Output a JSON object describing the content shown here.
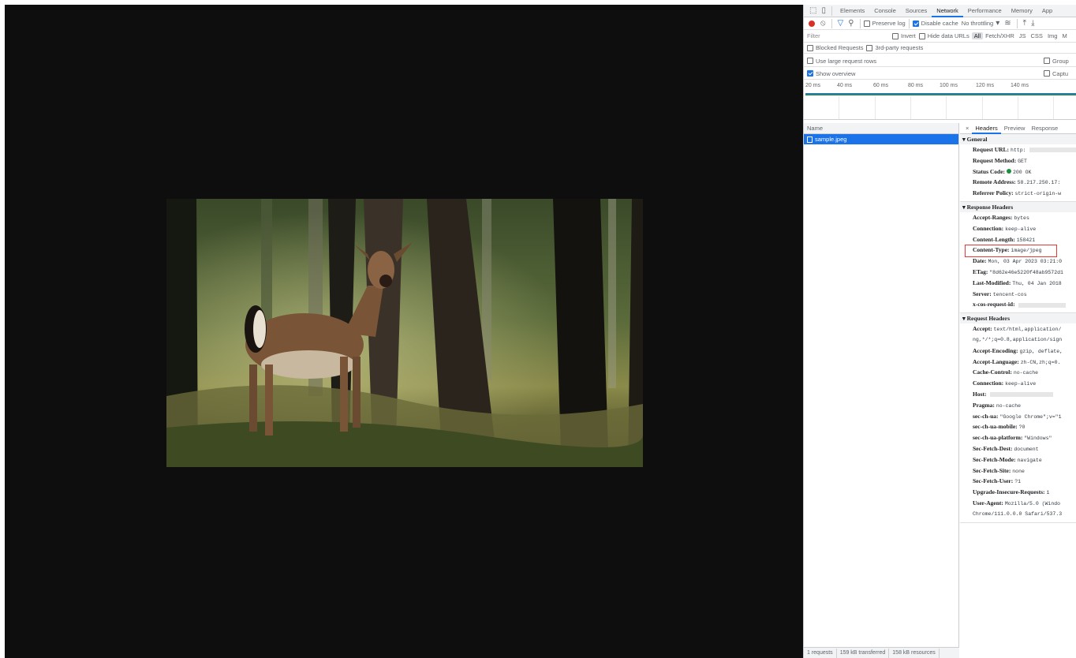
{
  "devtools": {
    "tabs": [
      "Elements",
      "Console",
      "Sources",
      "Network",
      "Performance",
      "Memory",
      "App"
    ],
    "active_tab": "Network",
    "toolbar": {
      "preserve_log": "Preserve log",
      "disable_cache": "Disable cache",
      "throttling": "No throttling"
    },
    "filter": {
      "placeholder": "Filter",
      "invert": "Invert",
      "hide_data_urls": "Hide data URLs",
      "types": [
        "All",
        "Fetch/XHR",
        "JS",
        "CSS",
        "Img",
        "M"
      ]
    },
    "blocked_requests": "Blocked Requests",
    "third_party": "3rd-party requests",
    "large_rows": "Use large request rows",
    "group_opt": "Group",
    "show_overview": "Show overview",
    "capture_opt": "Captu",
    "timeline_ticks": [
      "20 ms",
      "40 ms",
      "60 ms",
      "80 ms",
      "100 ms",
      "120 ms",
      "140 ms"
    ],
    "name_header": "Name",
    "requests": [
      {
        "name": "sample.jpeg"
      }
    ],
    "status_bar": [
      "1 requests",
      "159 kB transferred",
      "158 kB resources"
    ],
    "detail_tabs": [
      "×",
      "Headers",
      "Preview",
      "Response"
    ],
    "active_detail_tab": "Headers",
    "general": {
      "title": "General",
      "request_url_k": "Request URL:",
      "request_url_v": "http:",
      "method_k": "Request Method:",
      "method_v": "GET",
      "status_k": "Status Code:",
      "status_v": "200 OK",
      "remote_k": "Remote Address:",
      "remote_v": "58.217.250.17:",
      "referrer_k": "Referrer Policy:",
      "referrer_v": "strict-origin-w"
    },
    "response_headers": {
      "title": "Response Headers",
      "items": [
        {
          "k": "Accept-Ranges:",
          "v": "bytes"
        },
        {
          "k": "Connection:",
          "v": "keep-alive"
        },
        {
          "k": "Content-Length:",
          "v": "158421"
        },
        {
          "k": "Content-Type:",
          "v": "image/jpeg"
        },
        {
          "k": "Date:",
          "v": "Mon, 03 Apr 2023 03:21:0"
        },
        {
          "k": "ETag:",
          "v": "\"8d62e46e5220f48ab9572d1"
        },
        {
          "k": "Last-Modified:",
          "v": "Thu, 04 Jan 2018"
        },
        {
          "k": "Server:",
          "v": "tencent-cos"
        },
        {
          "k": "x-cos-request-id:",
          "v": ""
        }
      ]
    },
    "request_headers": {
      "title": "Request Headers",
      "items": [
        {
          "k": "Accept:",
          "v": "text/html,application/"
        },
        {
          "k": "",
          "v": "ng,*/*;q=0.8,application/sign"
        },
        {
          "k": "Accept-Encoding:",
          "v": "gzip, deflate,"
        },
        {
          "k": "Accept-Language:",
          "v": "zh-CN,zh;q=0."
        },
        {
          "k": "Cache-Control:",
          "v": "no-cache"
        },
        {
          "k": "Connection:",
          "v": "keep-alive"
        },
        {
          "k": "Host:",
          "v": ""
        },
        {
          "k": "Pragma:",
          "v": "no-cache"
        },
        {
          "k": "sec-ch-ua:",
          "v": "\"Google Chrome\";v=\"1"
        },
        {
          "k": "sec-ch-ua-mobile:",
          "v": "?0"
        },
        {
          "k": "sec-ch-ua-platform:",
          "v": "\"Windows\""
        },
        {
          "k": "Sec-Fetch-Dest:",
          "v": "document"
        },
        {
          "k": "Sec-Fetch-Mode:",
          "v": "navigate"
        },
        {
          "k": "Sec-Fetch-Site:",
          "v": "none"
        },
        {
          "k": "Sec-Fetch-User:",
          "v": "?1"
        },
        {
          "k": "Upgrade-Insecure-Requests:",
          "v": "1"
        },
        {
          "k": "User-Agent:",
          "v": "Mozilla/5.0 (Windo"
        },
        {
          "k": "",
          "v": "Chrome/111.0.0.0 Safari/537.3"
        }
      ]
    }
  },
  "colors": {
    "accent": "#1a73e8",
    "record": "#d93025",
    "highlight_box": "#e53935",
    "status_ok": "#1e8e3e",
    "viewport_bg": "#0e0e0e"
  }
}
